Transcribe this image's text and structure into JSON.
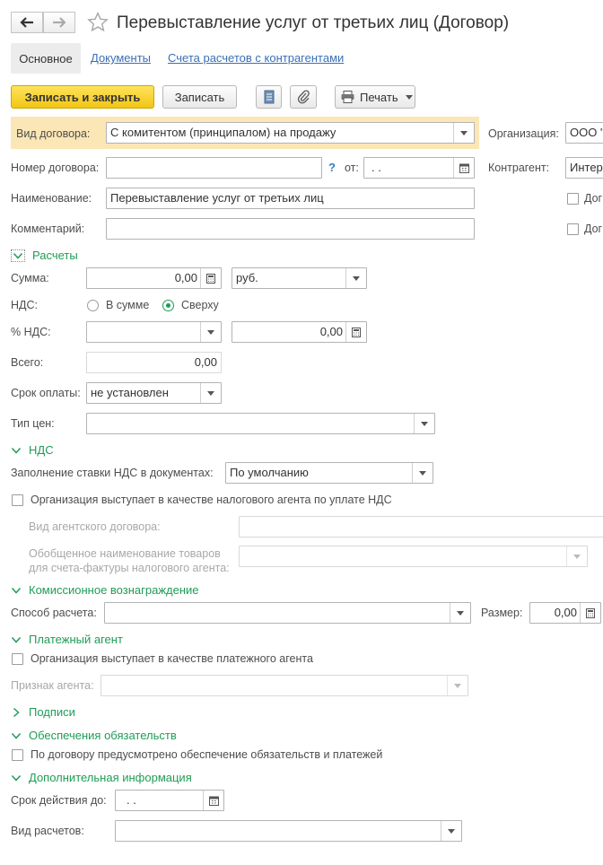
{
  "window": {
    "title": "Перевыставление услуг от третьих лиц (Договор)",
    "tabs": [
      "Основное",
      "Документы",
      "Счета расчетов с контрагентами"
    ]
  },
  "toolbar": {
    "save_close": "Записать и закрыть",
    "save": "Записать",
    "print": "Печать"
  },
  "form": {
    "contract_type_label": "Вид договора:",
    "contract_type_value": "С комитентом (принципалом) на продажу",
    "org_label": "Организация:",
    "org_value": "ООО \"",
    "number_label": "Номер договора:",
    "number_value": "",
    "help_mark": "?",
    "date_from_label": "от:",
    "date_from_value": " .  .",
    "counterparty_label": "Контрагент:",
    "counterparty_value": "Интерн",
    "name_label": "Наименование:",
    "name_value": "Перевыставление услуг от третьих лиц",
    "comment_label": "Комментарий:",
    "comment_value": "",
    "right_check1_label": "Дог",
    "right_check2_label": "Дог"
  },
  "settlements": {
    "header": "Расчеты",
    "sum_label": "Сумма:",
    "sum_value": "0,00",
    "currency_value": "руб.",
    "vat_label": "НДС:",
    "vat_option_in_sum": "В сумме",
    "vat_option_on_top": "Сверху",
    "vat_selected": "Сверху",
    "vat_rate_label": "% НДС:",
    "vat_rate_value": "",
    "vat_amount_value": "0,00",
    "total_label": "Всего:",
    "total_value": "0,00",
    "payment_term_label": "Срок оплаты:",
    "payment_term_value": "не установлен",
    "price_type_label": "Тип цен:",
    "price_type_value": ""
  },
  "vat_section": {
    "header": "НДС",
    "fill_rate_label": "Заполнение ставки НДС в документах:",
    "fill_rate_value": "По умолчанию",
    "tax_agent_label": "Организация выступает в качестве налогового агента по уплате НДС",
    "agent_contract_label": "Вид агентского договора:",
    "agent_contract_value": "",
    "goods_name_label_line1": "Обобщенное наименование товаров",
    "goods_name_label_line2": "для счета-фактуры налогового агента:",
    "goods_name_value": ""
  },
  "commission": {
    "header": "Комиссионное вознаграждение",
    "method_label": "Способ расчета:",
    "method_value": "",
    "size_label": "Размер:",
    "size_value": "0,00"
  },
  "payment_agent": {
    "header": "Платежный агент",
    "check_label": "Организация выступает в качестве платежного агента",
    "sign_label": "Признак агента:",
    "sign_value": ""
  },
  "signatures": {
    "header": "Подписи"
  },
  "obligations": {
    "header": "Обеспечения обязательств",
    "check_label": "По договору предусмотрено обеспечение обязательств и платежей"
  },
  "additional": {
    "header": "Дополнительная информация",
    "valid_until_label": "Срок действия до:",
    "valid_until_value": " .  .",
    "settlement_type_label": "Вид расчетов:",
    "settlement_type_value": ""
  },
  "colors": {
    "accent_green": "#1f9c57",
    "link_blue": "#3a6fb5",
    "primary_yellow": "#f7d330",
    "highlight_row": "#fbe6b5"
  }
}
